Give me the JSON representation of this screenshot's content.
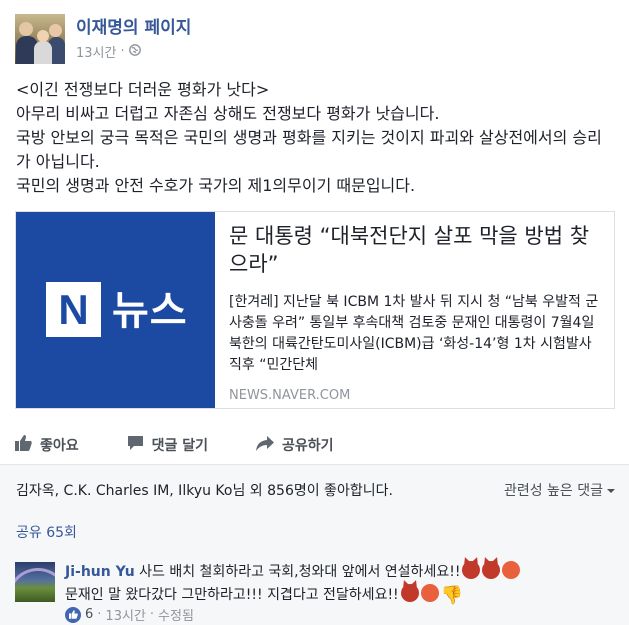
{
  "header": {
    "page_name": "이재명의 페이지",
    "time": "13시간",
    "separator": "·",
    "privacy_icon": "globe-icon"
  },
  "post": {
    "lines": [
      "<이긴 전쟁보다 더러운 평화가 낫다>",
      "아무리 비싸고 더럽고 자존심 상해도 전쟁보다 평화가 낫습니다.",
      "국방 안보의 궁극 목적은 국민의 생명과 평화를 지키는 것이지 파괴와 살상전에서의 승리가 아닙니다.",
      "국민의 생명과 안전 수호가 국가의 제1의무이기 때문입니다."
    ]
  },
  "link_card": {
    "thumb_letter": "N",
    "thumb_word": "뉴스",
    "title": "문 대통령 “대북전단지 살포 막을 방법 찾으라”",
    "description": "[한겨레] 지난달 북 ICBM 1차 발사 뒤 지시 청 “남북 우발적 군사충돌 우려” 통일부 후속대책 검토중 문재인 대통령이 7월4일 북한의 대륙간탄도미사일(ICBM)급 ‘화성-14’형 1차 시험발사 직후 “민간단체",
    "source": "NEWS.NAVER.COM",
    "colors": {
      "thumb_bg": "#1c4aa2"
    }
  },
  "actions": {
    "like": "좋아요",
    "comment": "댓글 달기",
    "share": "공유하기"
  },
  "engagement": {
    "likes_summary": "김자옥, C.K. Charles IM, Ilkyu Ko님 외 856명이 좋아합니다.",
    "sort_label": "관련성 높은 댓글",
    "shares": "공유 65회"
  },
  "comment": {
    "author": "Ji-hun Yu",
    "text_1": "사드 배치 철회하라고 국회,청와대 앞에서 연설하세요!!",
    "text_2": "문재인 말 왔다갔다 그만하라고!!! 지겹다고 전달하세요!!",
    "like_count": "6",
    "separator": "·",
    "time": "13시간",
    "edited": "수정됨"
  },
  "colors": {
    "link_blue": "#365899",
    "muted": "#90949c",
    "panel_bg": "#f6f7f9"
  }
}
